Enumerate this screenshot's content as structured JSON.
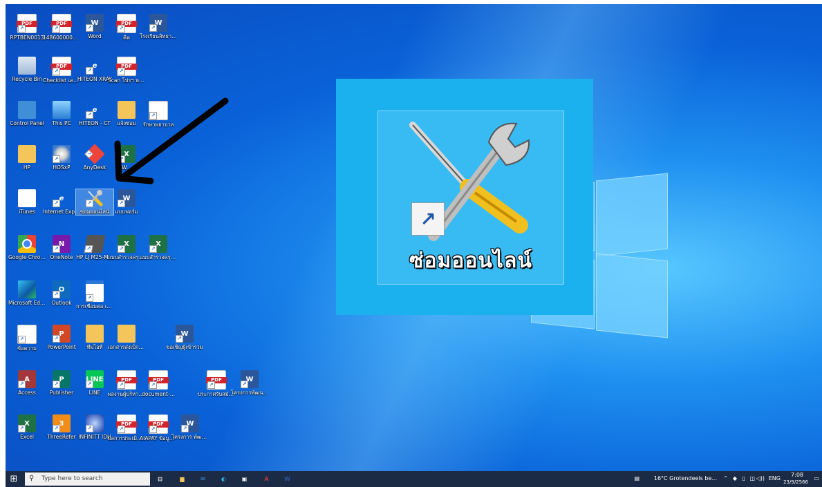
{
  "desktop": {
    "icons": [
      {
        "label": "RPTBEN0013",
        "type": "pdf"
      },
      {
        "label": "14860000000...",
        "type": "pdf"
      },
      {
        "label": "Word",
        "type": "word"
      },
      {
        "label": "คิด",
        "type": "pdf"
      },
      {
        "label": "โรงเรียนสิทธา ศึกษาฯ ฯ.ม.",
        "type": "word"
      },
      {
        "label": "Recycle Bin",
        "type": "recycle"
      },
      {
        "label": "Checklist เครื่องฯ",
        "type": "pdf"
      },
      {
        "label": "HITEON XRAY",
        "type": "ie"
      },
      {
        "label": "Scan โปรฯ หนังสือขออนุญาต",
        "type": "pdf"
      },
      {
        "label": "Control Panel",
        "type": "cp"
      },
      {
        "label": "This PC",
        "type": "pc"
      },
      {
        "label": "HITEON - CT",
        "type": "ie"
      },
      {
        "label": "แจ้งซ่อม",
        "type": "folder"
      },
      {
        "label": "รักษาพยาบาล",
        "type": "doc"
      },
      {
        "label": "HP",
        "type": "folder"
      },
      {
        "label": "HOSxP",
        "type": "hosxp"
      },
      {
        "label": "AnyDesk",
        "type": "anydesk"
      },
      {
        "label": "W...",
        "type": "excel"
      },
      {
        "label": "iTunes",
        "type": "itunes"
      },
      {
        "label": "Internet Explorer",
        "type": "ie"
      },
      {
        "label": "ซ่อมออนไลน์",
        "type": "tools"
      },
      {
        "label": "แบบฟอร์ม",
        "type": "word"
      },
      {
        "label": "Google Chrome",
        "type": "chrome"
      },
      {
        "label": "OneNote",
        "type": "onenote"
      },
      {
        "label": "HP LJ M25-M...",
        "type": "hp"
      },
      {
        "label": "แบบสำรวจครุภัณฑ์ ประจำปี 65",
        "type": "excel"
      },
      {
        "label": "แบบสำรวจครุภัณฑ์ ประจำปี 66",
        "type": "excel"
      },
      {
        "label": "Microsoft Edge",
        "type": "edge"
      },
      {
        "label": "Outlook",
        "type": "outlook"
      },
      {
        "label": "การเชื่อมต่อ เดสก์ท็อประยะไกล",
        "type": "rdp"
      },
      {
        "label": "ข้อความ",
        "type": "doc"
      },
      {
        "label": "PowerPoint",
        "type": "ppt"
      },
      {
        "label": "ทีมไอที",
        "type": "folder"
      },
      {
        "label": "เอกสารส่งเบิก ค่ารักษาพยาบาล",
        "type": "folder"
      },
      {
        "label": "ขอเชิญผู้เข้าร่วม",
        "type": "word"
      },
      {
        "label": "Access",
        "type": "access"
      },
      {
        "label": "Publisher",
        "type": "pub"
      },
      {
        "label": "LINE",
        "type": "line"
      },
      {
        "label": "ผลงานผู้บริหาร ผู้บริหาร",
        "type": "pdf"
      },
      {
        "label": "document-...",
        "type": "pdf"
      },
      {
        "label": "ประกาศรับสมัคร 5",
        "type": "pdf"
      },
      {
        "label": "โครงการพัฒนา สมรรถนะบุคลากร",
        "type": "word"
      },
      {
        "label": "Excel",
        "type": "excel"
      },
      {
        "label": "ThreeRefer",
        "type": "three"
      },
      {
        "label": "INFINITT IDH",
        "type": "inf"
      },
      {
        "label": "ผลการประเมิน ผู้บริหาร",
        "type": "pdf"
      },
      {
        "label": "AIAPAY ข้อมูล (1)",
        "type": "pdf"
      },
      {
        "label": "โครงการ พัฒนาบุคลากร",
        "type": "word"
      }
    ],
    "zoomed_icon": {
      "label": "ซ่อมออนไลน์"
    }
  },
  "taskbar": {
    "search_placeholder": "Type here to search",
    "apps": [
      {
        "name": "task-view",
        "glyph": "⊟",
        "color": "#ffffff"
      },
      {
        "name": "file-explorer",
        "glyph": "▆",
        "color": "#f3c55a"
      },
      {
        "name": "mail",
        "glyph": "✉",
        "color": "#3a96dd"
      },
      {
        "name": "edge",
        "glyph": "◐",
        "color": "#35c1f1"
      },
      {
        "name": "store",
        "glyph": "▣",
        "color": "#ffffff"
      },
      {
        "name": "access",
        "glyph": "A",
        "color": "#c0393b"
      },
      {
        "name": "word",
        "glyph": "W",
        "color": "#2b579a"
      }
    ],
    "weather": "16°C  Grotendeels be...",
    "language": "ENG",
    "time": "7:08",
    "date": "23/9/2566"
  }
}
